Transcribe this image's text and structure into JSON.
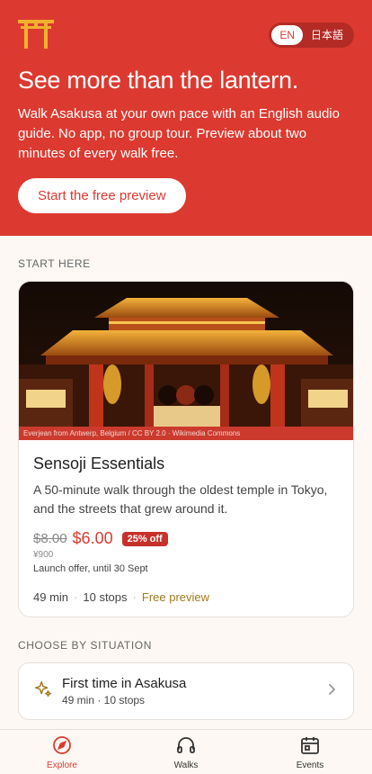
{
  "colors": {
    "brand": "#dc3a30",
    "accent_gold": "#a1791c",
    "background": "#fdf8f3"
  },
  "header": {
    "logo_icon": "torii-gate-icon",
    "lang_options": [
      "EN",
      "日本語"
    ],
    "lang_selected": "EN"
  },
  "hero": {
    "title": "See more than the lantern.",
    "body": "Walk Asakusa at your own pace with an English audio guide. No app, no group tour. Preview about two minutes of every walk free.",
    "cta_label": "Start the free preview"
  },
  "start_here": {
    "section_label": "START HERE",
    "card": {
      "image_credit": "Everjean from Antwerp, Belgium / CC BY 2.0 · Wikimedia Commons",
      "title": "Sensoji Essentials",
      "description": "A 50-minute walk through the oldest temple in Tokyo, and the streets that grew around it.",
      "old_price": "$8.00",
      "new_price": "$6.00",
      "discount_badge": "25% off",
      "yen_price": "¥900",
      "offer_note": "Launch offer, until 30 Sept",
      "duration": "49 min",
      "stops": "10 stops",
      "free_label": "Free preview"
    }
  },
  "situations": {
    "section_label": "CHOOSE BY SITUATION",
    "items": [
      {
        "icon": "sparkle-icon",
        "title": "First time in Asakusa",
        "subtitle": "49 min · 10 stops"
      }
    ]
  },
  "bottom_nav": {
    "items": [
      {
        "label": "Explore",
        "icon": "compass-icon",
        "active": true
      },
      {
        "label": "Walks",
        "icon": "headphones-icon",
        "active": false
      },
      {
        "label": "Events",
        "icon": "calendar-icon",
        "active": false
      }
    ]
  }
}
